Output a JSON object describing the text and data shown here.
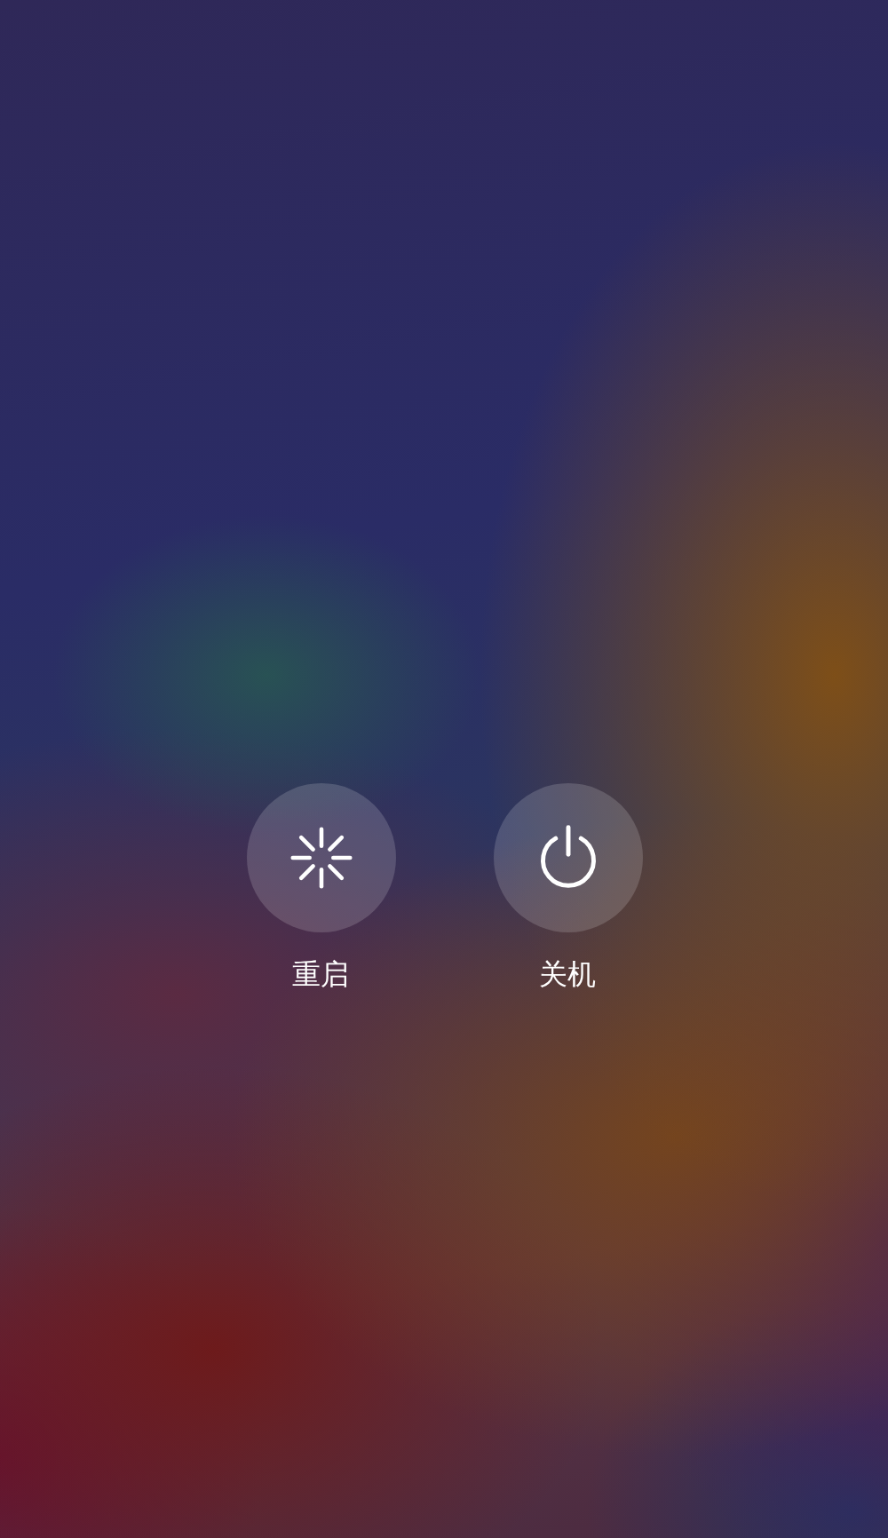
{
  "actions": [
    {
      "kind": "restart",
      "label": "重启"
    },
    {
      "kind": "power",
      "label": "关机"
    }
  ]
}
